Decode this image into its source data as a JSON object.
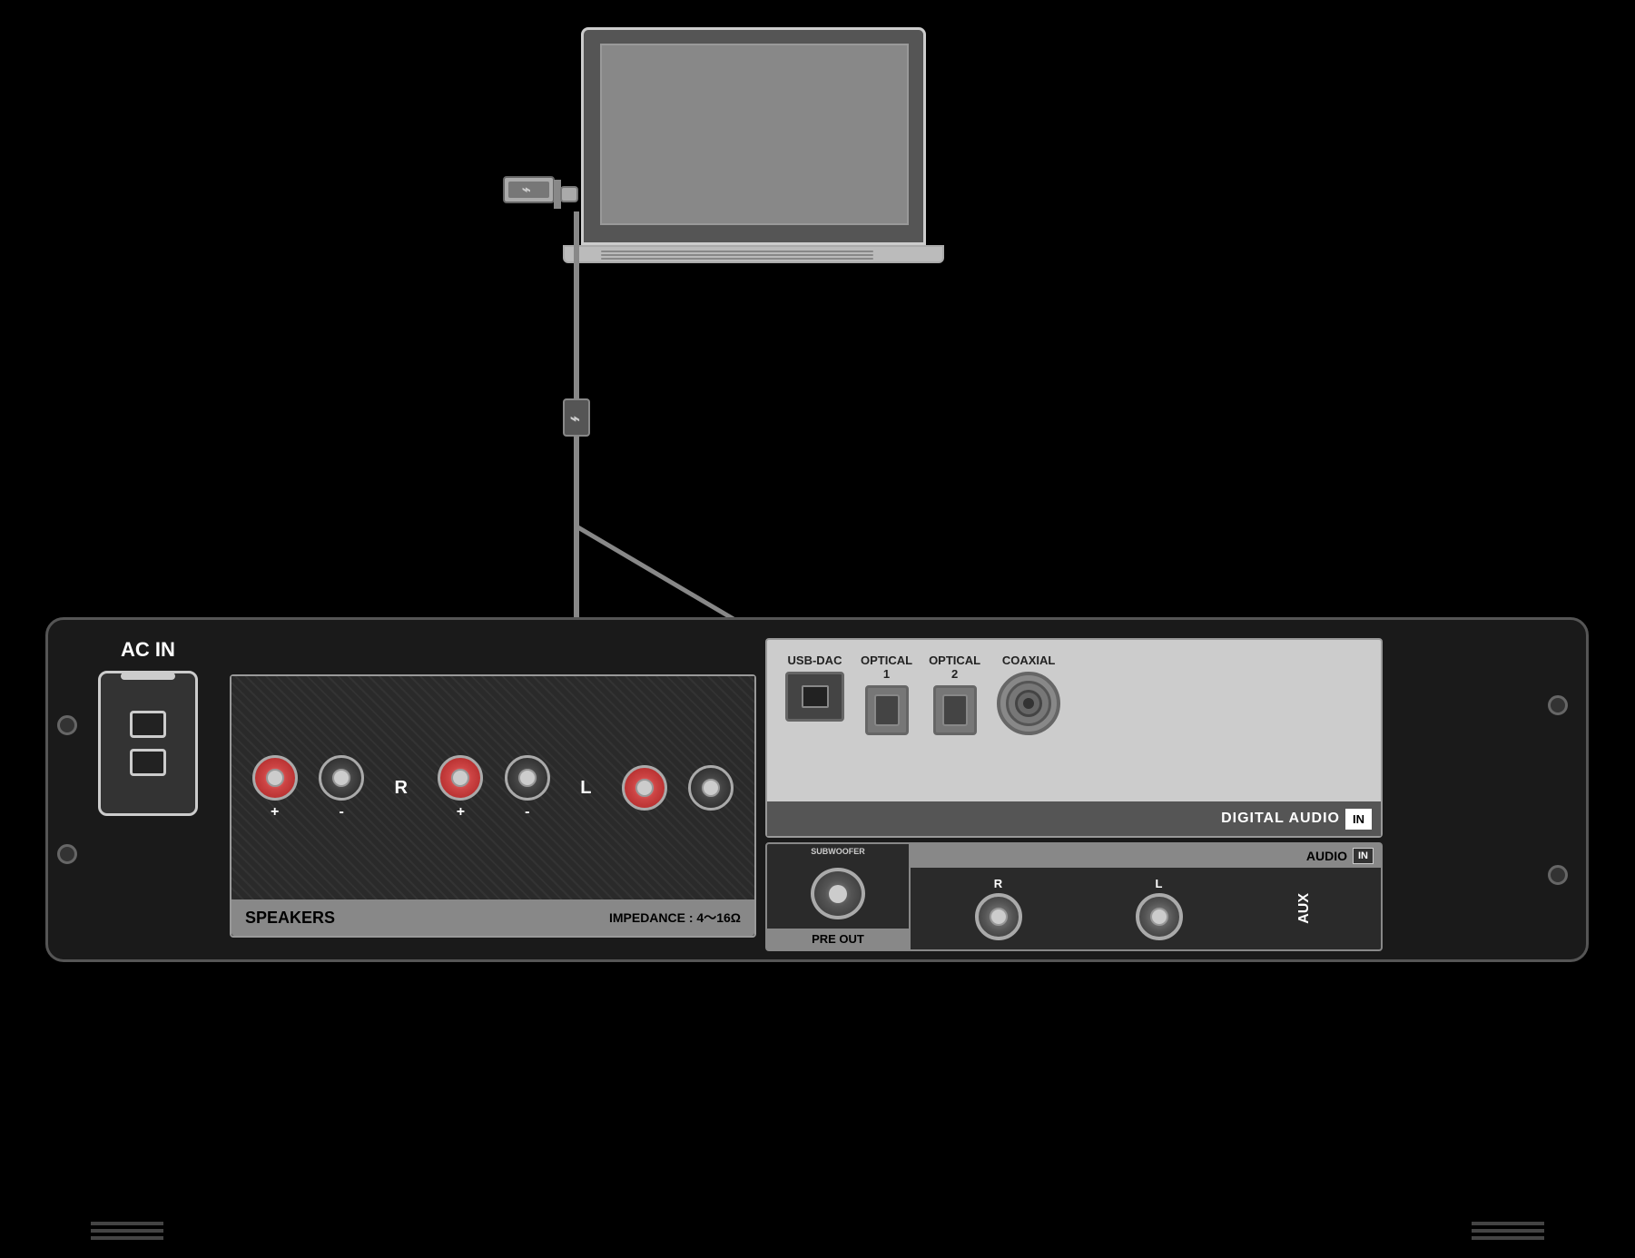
{
  "labels": {
    "ac_in": "AC\nIN",
    "speakers": "SPEAKERS",
    "impedance": "IMPEDANCE : 4～16Ω",
    "digital_audio": "DIGITAL AUDIO",
    "in_badge": "IN",
    "usb_dac": "USB-DAC",
    "optical1": "OPTICAL\n1",
    "optical2": "OPTICAL\n2",
    "coaxial": "COAXIAL",
    "pre_out": "PRE OUT",
    "audio": "AUDIO",
    "aux": "AUX",
    "subwoofer": "SUBWOOFER",
    "r_label": "R",
    "l_label": "L",
    "usb_symbol": "⌁"
  },
  "colors": {
    "background": "#000000",
    "panel_bg": "#1a1a1a",
    "panel_border": "#555555",
    "light_bg": "#cccccc",
    "dark_label": "#000000",
    "white_text": "#ffffff",
    "accent_bar": "#888888"
  }
}
